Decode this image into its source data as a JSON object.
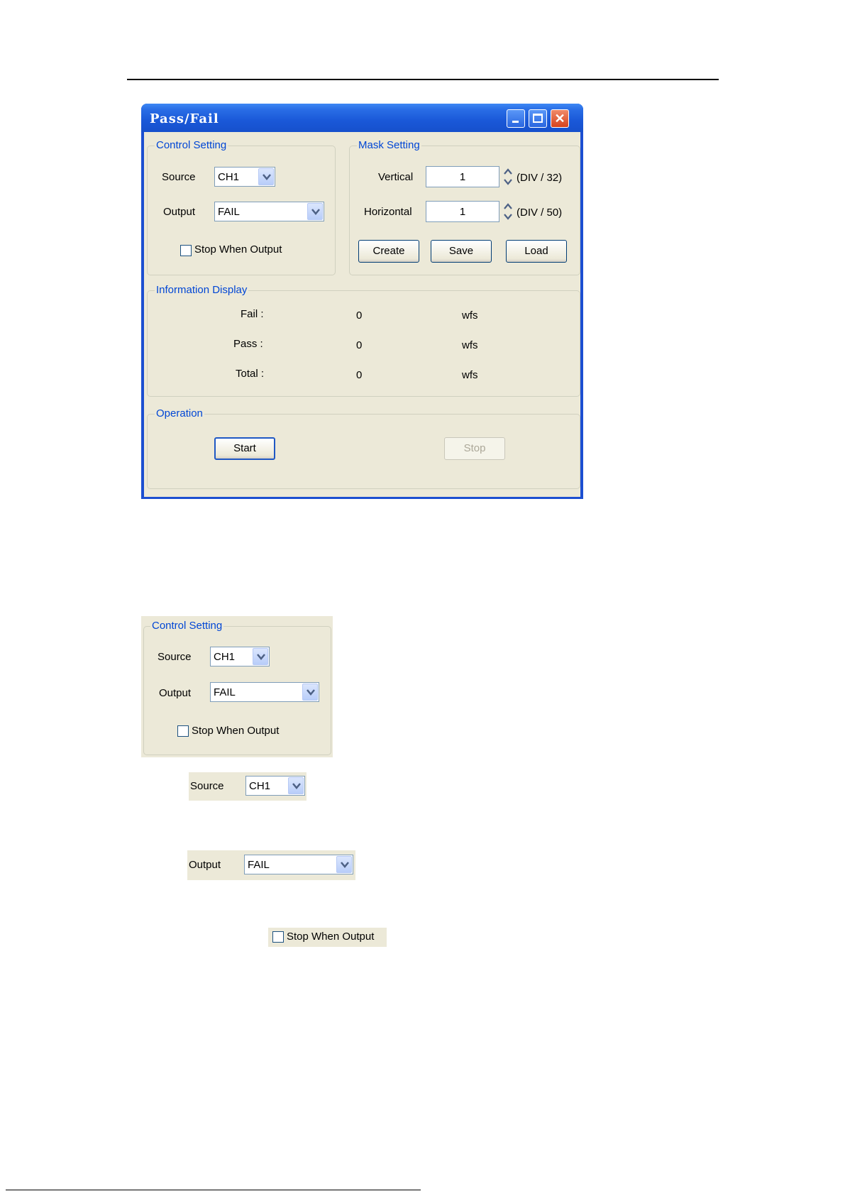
{
  "window": {
    "title": "Pass/Fail"
  },
  "control_setting": {
    "legend": "Control Setting",
    "source_label": "Source",
    "source_value": "CH1",
    "output_label": "Output",
    "output_value": "FAIL",
    "stop_when_output_label": "Stop When Output",
    "stop_when_output_checked": false
  },
  "mask_setting": {
    "legend": "Mask Setting",
    "vertical_label": "Vertical",
    "vertical_value": "1",
    "vertical_unit": "(DIV / 32)",
    "horizontal_label": "Horizontal",
    "horizontal_value": "1",
    "horizontal_unit": "(DIV / 50)",
    "create_label": "Create",
    "save_label": "Save",
    "load_label": "Load"
  },
  "information_display": {
    "legend": "Information Display",
    "rows": [
      {
        "label": "Fail :",
        "value": "0",
        "unit": "wfs"
      },
      {
        "label": "Pass :",
        "value": "0",
        "unit": "wfs"
      },
      {
        "label": "Total :",
        "value": "0",
        "unit": "wfs"
      }
    ]
  },
  "operation": {
    "legend": "Operation",
    "start_label": "Start",
    "stop_label": "Stop"
  },
  "colors": {
    "titlebar": "#1a58d8",
    "dialog_bg": "#ece9d8",
    "legend_text": "#0046d5"
  }
}
